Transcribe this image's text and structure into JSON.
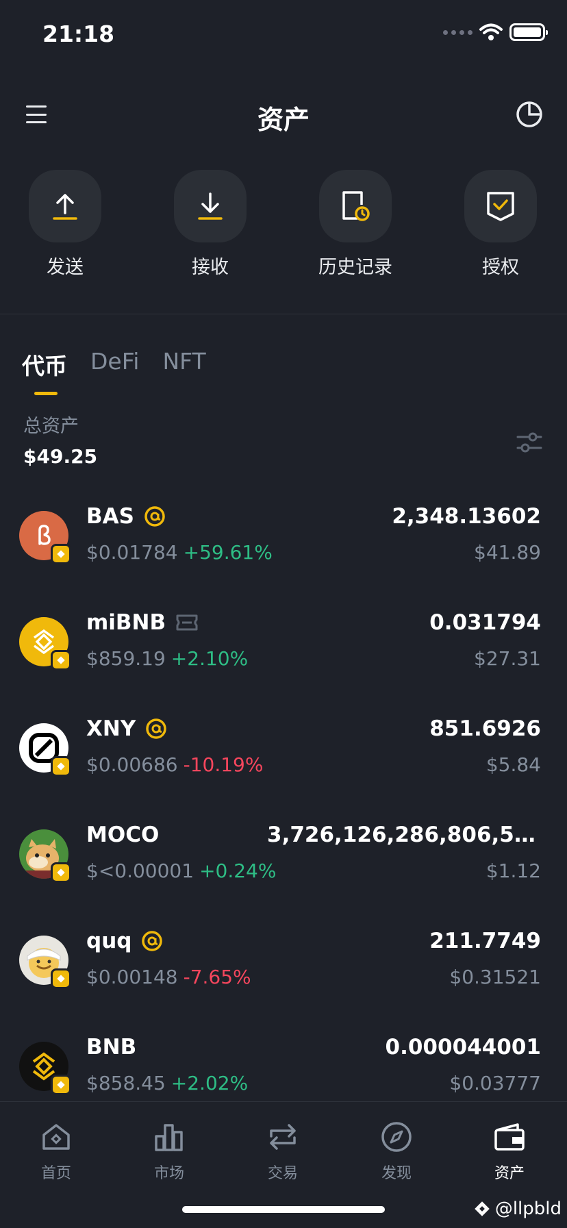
{
  "status_bar": {
    "time": "21:18"
  },
  "header": {
    "title": "资产"
  },
  "actions": [
    {
      "label": "发送",
      "icon": "send-arrow-up-icon"
    },
    {
      "label": "接收",
      "icon": "receive-arrow-down-icon"
    },
    {
      "label": "历史记录",
      "icon": "history-document-clock-icon"
    },
    {
      "label": "授权",
      "icon": "authorize-shield-check-icon"
    }
  ],
  "tabs": [
    {
      "label": "代币"
    },
    {
      "label": "DeFi"
    },
    {
      "label": "NFT"
    }
  ],
  "summary": {
    "total_label": "总资产",
    "total_value": "$49.25"
  },
  "tokens": [
    {
      "symbol": "BAS",
      "tag_icon": "at-sign-icon",
      "price": "$0.01784",
      "change": "+59.61%",
      "direction": "up",
      "amount": "2,348.13602",
      "value": "$41.89",
      "logo_color": "#d96a45"
    },
    {
      "symbol": "miBNB",
      "tag_icon": "ticket-icon",
      "price": "$859.19",
      "change": "+2.10%",
      "direction": "up",
      "amount": "0.031794",
      "value": "$27.31",
      "logo_color": "#f0b90b"
    },
    {
      "symbol": "XNY",
      "tag_icon": "at-sign-icon",
      "price": "$0.00686",
      "change": "-10.19%",
      "direction": "down",
      "amount": "851.6926",
      "value": "$5.84",
      "logo_color": "#ffffff"
    },
    {
      "symbol": "MOCO",
      "tag_icon": "",
      "price": "$<0.00001",
      "change": "+0.24%",
      "direction": "up",
      "amount": "3,726,126,286,806,54...",
      "value": "$1.12",
      "logo_color": "#4a8f3c"
    },
    {
      "symbol": "quq",
      "tag_icon": "at-sign-icon",
      "price": "$0.00148",
      "change": "-7.65%",
      "direction": "down",
      "amount": "211.7749",
      "value": "$0.31521",
      "logo_color": "#e8e6e0"
    },
    {
      "symbol": "BNB",
      "tag_icon": "",
      "price": "$858.45",
      "change": "+2.02%",
      "direction": "up",
      "amount": "0.000044001",
      "value": "$0.03777",
      "logo_color": "#111111"
    }
  ],
  "bottom_nav": [
    {
      "label": "首页",
      "icon": "home-icon"
    },
    {
      "label": "市场",
      "icon": "market-bar-chart-icon"
    },
    {
      "label": "交易",
      "icon": "trade-swap-icon"
    },
    {
      "label": "发现",
      "icon": "discover-compass-icon"
    },
    {
      "label": "资产",
      "icon": "wallet-icon",
      "active": true
    }
  ],
  "watermark": {
    "text": "@llpbld"
  },
  "colors": {
    "background": "#1e2129",
    "accent": "#f0b90b",
    "up": "#2ebd85",
    "down": "#f6465d",
    "muted": "#848e9c"
  }
}
